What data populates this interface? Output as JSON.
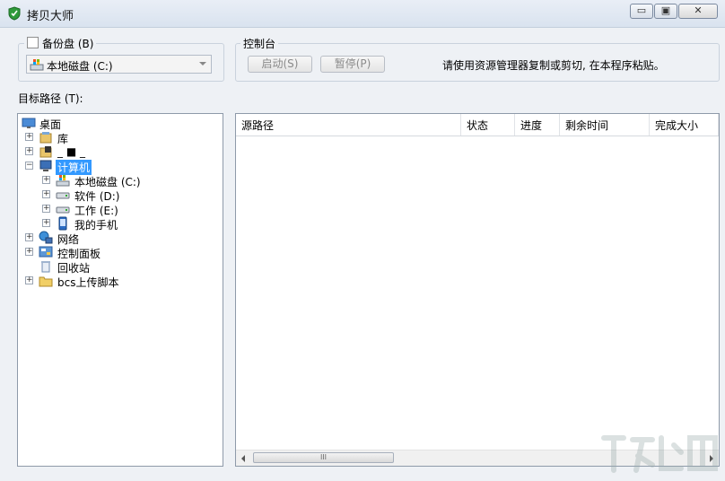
{
  "window": {
    "title": "拷贝大师"
  },
  "backup": {
    "legend": "备份盘 (B)",
    "drive_selected": "本地磁盘 (C:)"
  },
  "console": {
    "legend": "控制台",
    "start_label": "启动(S)",
    "pause_label": "暂停(P)",
    "hint": "请使用资源管理器复制或剪切, 在本程序粘贴。"
  },
  "target_label": "目标路径 (T):",
  "tree": {
    "desktop": "桌面",
    "library": "库",
    "user": "_ ■ _",
    "computer": "计算机",
    "drive_c": "本地磁盘 (C:)",
    "drive_d": "软件 (D:)",
    "drive_e": "工作 (E:)",
    "phone": "我的手机",
    "network": "网络",
    "control_panel": "控制面板",
    "recycle_bin": "回收站",
    "bcs_folder": "bcs上传脚本"
  },
  "list": {
    "columns": [
      "源路径",
      "状态",
      "进度",
      "剩余时间",
      "完成大小"
    ]
  },
  "scrollbar": {
    "thumb_glyph": "III"
  },
  "colors": {
    "selection": "#3399ff",
    "accent_green": "#2e9a3a"
  }
}
